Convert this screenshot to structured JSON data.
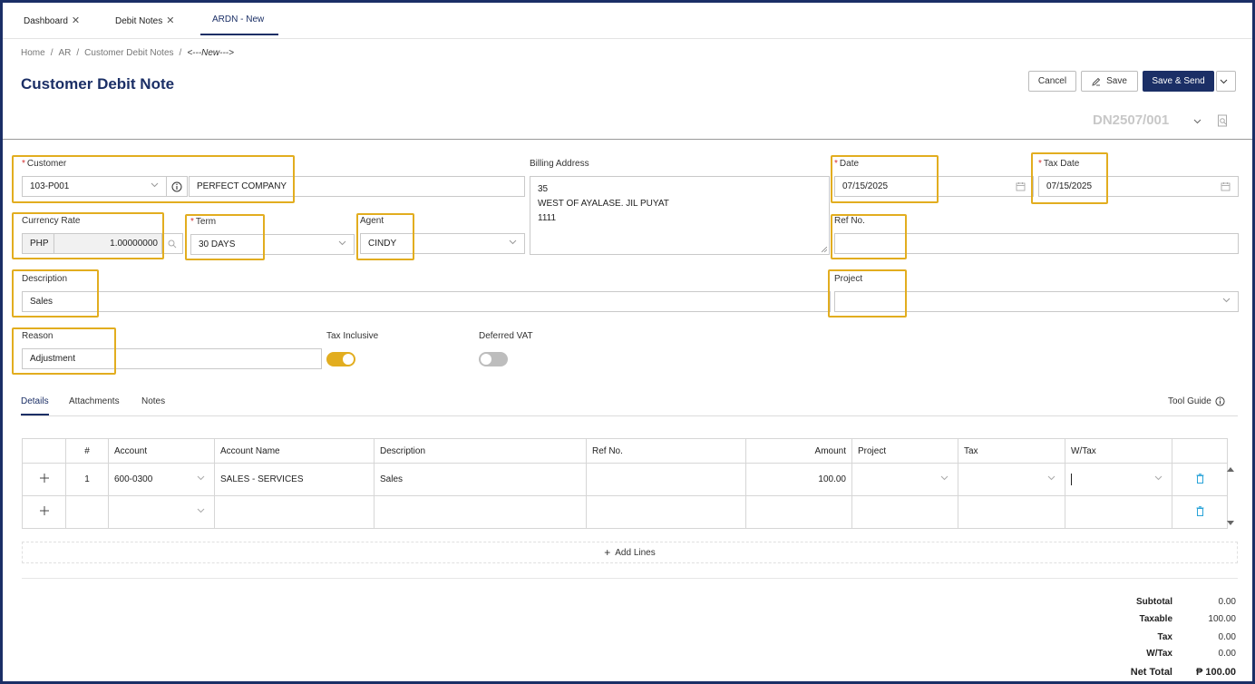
{
  "tabs": [
    {
      "label": "Dashboard"
    },
    {
      "label": "Debit Notes"
    },
    {
      "label": "ARDN - New"
    }
  ],
  "breadcrumb": [
    "Home",
    "AR",
    "Customer Debit Notes",
    "<---New--->"
  ],
  "page_title": "Customer Debit Note",
  "toolbar": {
    "cancel": "Cancel",
    "save": "Save",
    "save_send": "Save & Send"
  },
  "doc_number": "DN2507/001",
  "form": {
    "customer": {
      "label": "Customer",
      "code": "103-P001",
      "name": "PERFECT COMPANY"
    },
    "billing_address": {
      "label": "Billing Address",
      "line1": "35",
      "line2": "WEST OF AYALASE. JIL PUYAT",
      "line3": "1111"
    },
    "date": {
      "label": "Date",
      "value": "07/15/2025"
    },
    "tax_date": {
      "label": "Tax Date",
      "value": "07/15/2025"
    },
    "currency_rate": {
      "label": "Currency Rate",
      "currency": "PHP",
      "rate": "1.00000000"
    },
    "term": {
      "label": "Term",
      "value": "30 DAYS"
    },
    "agent": {
      "label": "Agent",
      "value": "CINDY"
    },
    "ref_no": {
      "label": "Ref No.",
      "value": ""
    },
    "description": {
      "label": "Description",
      "value": "Sales"
    },
    "project": {
      "label": "Project",
      "value": ""
    },
    "reason": {
      "label": "Reason",
      "value": "Adjustment"
    },
    "tax_inclusive": {
      "label": "Tax Inclusive",
      "on": true
    },
    "deferred_vat": {
      "label": "Deferred VAT",
      "on": false
    }
  },
  "subtabs": [
    {
      "label": "Details"
    },
    {
      "label": "Attachments"
    },
    {
      "label": "Notes"
    }
  ],
  "tool_guide": "Tool Guide",
  "table": {
    "headers": [
      "",
      "#",
      "Account",
      "Account Name",
      "Description",
      "Ref No.",
      "Amount",
      "Project",
      "Tax",
      "W/Tax",
      ""
    ],
    "rows": [
      {
        "num": "1",
        "account": "600-0300",
        "account_name": "SALES - SERVICES",
        "description": "Sales",
        "ref_no": "",
        "amount": "100.00",
        "project": "",
        "tax": "",
        "wtax": ""
      },
      {
        "num": "",
        "account": "",
        "account_name": "",
        "description": "",
        "ref_no": "",
        "amount": "",
        "project": "",
        "tax": "",
        "wtax": ""
      }
    ]
  },
  "add_lines": "Add Lines",
  "totals": {
    "subtotal": {
      "label": "Subtotal",
      "value": "0.00"
    },
    "taxable": {
      "label": "Taxable",
      "value": "100.00"
    },
    "tax": {
      "label": "Tax",
      "value": "0.00"
    },
    "wtax": {
      "label": "W/Tax",
      "value": "0.00"
    },
    "net_total": {
      "label": "Net Total",
      "value": "₱ 100.00"
    }
  },
  "colors": {
    "brand": "#1b2f66",
    "highlight": "#e2ad1f",
    "toggle_on": "#e2ad1f",
    "toggle_off": "#bdbdbd",
    "delete_icon": "#29a3d8"
  }
}
